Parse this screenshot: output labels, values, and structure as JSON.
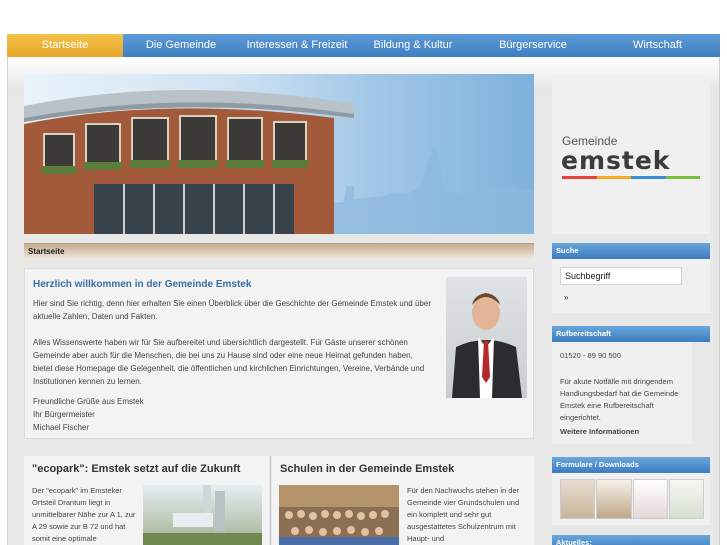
{
  "nav": {
    "items": [
      {
        "label": "Startseite",
        "active": true
      },
      {
        "label": "Die Gemeinde",
        "active": false
      },
      {
        "label": "Interessen & Freizeit",
        "active": false
      },
      {
        "label": "Bildung & Kultur",
        "active": false
      },
      {
        "label": "Bürgerservice",
        "active": false
      },
      {
        "label": "Wirtschaft",
        "active": false
      }
    ]
  },
  "logo": {
    "small": "Gemeinde",
    "big": "emstek",
    "stripe_colors": [
      "#e8403a",
      "#f5a623",
      "#3a8fd6",
      "#7cbf3f"
    ]
  },
  "breadcrumb": "Startseite",
  "welcome": {
    "title": "Herzlich willkommen in der Gemeinde Emstek",
    "p1": "Hier sind Sie richtig, denn hier erhalten Sie einen Überblick über die Geschichte der Gemeinde Emstek und über aktuelle Zahlen, Daten und Fakten.",
    "p2": "Alles Wissenswerte haben wir für Sie aufbereitet und übersichtlich dargestellt. Für Gäste unserer schönen Gemeinde aber auch für die Menschen, die bei uns zu Hause sind oder eine neue Heimat gefunden haben, bietet diese Homepage die Gelegenheit, die öffentlichen und kirchlichen Einrichtungen, Vereine, Verbände und Institutionen kennen zu lernen.",
    "g1": "Freundliche Grüße aus Emstek",
    "g2": "Ihr Bürgermeister",
    "g3": "Michael Fischer"
  },
  "ecopark": {
    "title": "\"ecopark\": Emstek setzt auf die Zukunft",
    "text": "Der \"ecopark\" im Emsteker Ortsteil Drantum liegt in unmittelbarer Nähe zur A 1, zur A 29 sowie zur B 72 und hat somit eine optimale"
  },
  "schulen": {
    "title": "Schulen in der Gemeinde Emstek",
    "text": "Für den Nachwuchs stehen in der Gemeinde vier Grundschulen und ein komplett und sehr gut ausgestattetes Schulzentrum mit Haupt- und"
  },
  "sidebar": {
    "suche_title": "Suche",
    "search_value": "Suchbegriff",
    "search_button": "»",
    "ruf_title": "Rufbereitschaft",
    "phone": "01520 - 89 90 500",
    "ruf_text": "Für akute Notfälle mit dringendem Handlungsbedarf hat die Gemeinde Emstek eine Rufbereitschaft eingerichtet.",
    "ruf_link": "Weitere Informationen",
    "forms_title": "Formulare / Downloads",
    "aktuelles_title": "Aktuelles:"
  }
}
